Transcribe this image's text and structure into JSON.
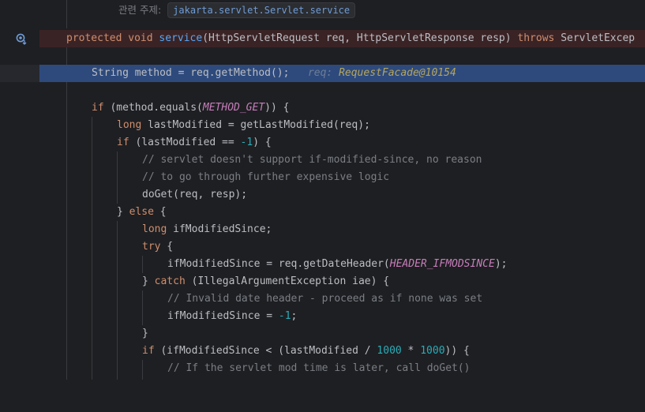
{
  "hint": {
    "label": "관련 주제:",
    "target": "jakarta.servlet.Servlet.service"
  },
  "lines": {
    "l1": {
      "kw1": "protected",
      "kw2": "void",
      "fn": "service",
      "rest": "(HttpServletRequest req, HttpServletResponse resp)",
      "kw3": "throws",
      "tail": "ServletExcep"
    },
    "l2": {
      "code": "String method = req.getMethod();",
      "dbg_name": "req:",
      "dbg_val": "RequestFacade@10154"
    },
    "l3": {
      "kw": "if",
      "a": " (method.equals(",
      "const": "METHOD_GET",
      "b": ")) {"
    },
    "l4": {
      "kw": "long",
      "a": " lastModified = getLastModified(req);"
    },
    "l5": {
      "kw": "if",
      "a": " (lastModified == ",
      "num": "-1",
      "b": ") {"
    },
    "l6": "// servlet doesn't support if-modified-since, no reason",
    "l7": "// to go through further expensive logic",
    "l8": "doGet(req, resp);",
    "l9": {
      "a": "} ",
      "kw": "else",
      "b": " {"
    },
    "l10": {
      "kw": "long",
      "a": " ifModifiedSince;"
    },
    "l11": {
      "kw": "try",
      "a": " {"
    },
    "l12": {
      "a": "ifModifiedSince = req.getDateHeader(",
      "const": "HEADER_IFMODSINCE",
      "b": ");"
    },
    "l13": {
      "a": "} ",
      "kw": "catch",
      "b": " (IllegalArgumentException iae) {"
    },
    "l14": "// Invalid date header - proceed as if none was set",
    "l15": {
      "a": "ifModifiedSince = ",
      "num": "-1",
      "b": ";"
    },
    "l16": "}",
    "l17": {
      "kw": "if",
      "a": " (ifModifiedSince < (lastModified / ",
      "num1": "1000",
      "op": " * ",
      "num2": "1000",
      "b": ")) {"
    },
    "l18": "// If the servlet mod time is later, call doGet()"
  },
  "colors": {
    "background": "#1e1f22",
    "keyword": "#cf8e6d",
    "function": "#56a8f5",
    "comment": "#7a7e85",
    "number": "#2aacb8",
    "constant": "#c77dbb",
    "execution_highlight": "#2e4a7c",
    "breakpoint_line": "#3a2325"
  },
  "icons": {
    "gutter_debug": "debug-breakpoint-icon"
  }
}
